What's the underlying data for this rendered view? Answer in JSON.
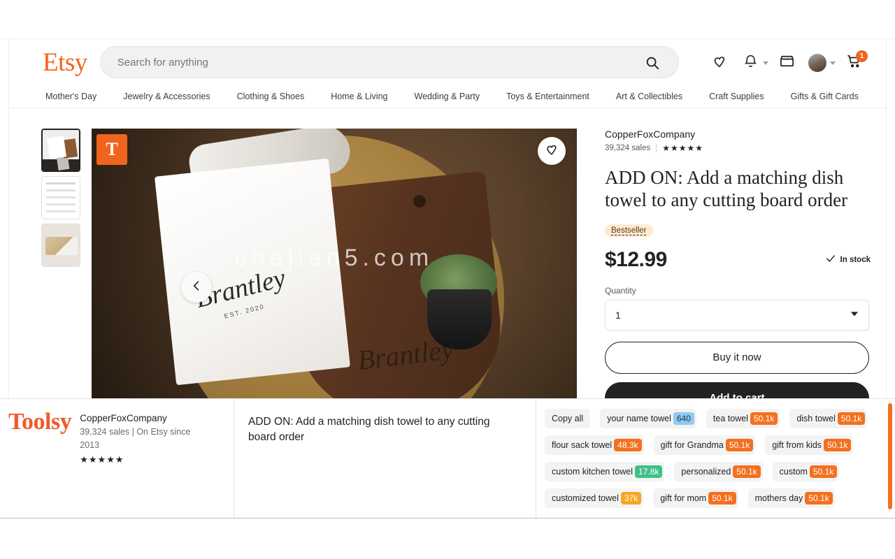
{
  "header": {
    "logo_text": "Etsy",
    "search": {
      "placeholder": "Search for anything",
      "value": ""
    },
    "icons": {
      "favorites": "heart-icon",
      "notifications": "bell-icon",
      "shop_manager": "storefront-icon",
      "account": "avatar-icon",
      "cart": "cart-icon"
    },
    "cart_count": "1",
    "nav": [
      "Mother's Day",
      "Jewelry & Accessories",
      "Clothing & Shoes",
      "Home & Living",
      "Wedding & Party",
      "Toys & Entertainment",
      "Art & Collectibles",
      "Craft Supplies",
      "Gifts & Gift Cards"
    ]
  },
  "gallery": {
    "badge_letter": "T",
    "favorite_label": "♡",
    "prev_label": "‹",
    "next_label": "›",
    "watermark": "chajian5.com",
    "towel_script": "Brantley",
    "towel_est": "EST. 2020",
    "board_script": "Brantley",
    "thumbnails": [
      {
        "name": "thumbnail-1",
        "alt": "Add on dish towel product photo"
      },
      {
        "name": "thumbnail-2",
        "alt": "Listing description text image"
      },
      {
        "name": "thumbnail-3",
        "alt": "Cutting board with towel photo"
      }
    ]
  },
  "listing": {
    "shop_name": "CopperFoxCompany",
    "sales": "39,324 sales",
    "stars": "★★★★★",
    "title": "ADD ON: Add a matching dish towel to any cutting board order",
    "badge": "Bestseller",
    "price": "$12.99",
    "stock": "In stock",
    "quantity_label": "Quantity",
    "quantity_value": "1",
    "buy_now_label": "Buy it now",
    "add_to_cart_label": "Add to cart"
  },
  "toolsy": {
    "logo_text": "Toolsy",
    "shop_name": "CopperFoxCompany",
    "shop_meta": "39,324 sales | On Etsy since 2013",
    "stars": "★★★★★",
    "listing_title": "ADD ON: Add a matching dish towel to any cutting board order",
    "copy_all_label": "Copy all",
    "tags": [
      {
        "label": "your name towel",
        "count": "640",
        "color": "blue"
      },
      {
        "label": "tea towel",
        "count": "50.1k",
        "color": "orange"
      },
      {
        "label": "dish towel",
        "count": "50.1k",
        "color": "orange"
      },
      {
        "label": "flour sack towel",
        "count": "48.3k",
        "color": "orange"
      },
      {
        "label": "gift for Grandma",
        "count": "50.1k",
        "color": "orange"
      },
      {
        "label": "gift from kids",
        "count": "50.1k",
        "color": "orange"
      },
      {
        "label": "custom kitchen towel",
        "count": "17.8k",
        "color": "green"
      },
      {
        "label": "personalized",
        "count": "50.1k",
        "color": "orange"
      },
      {
        "label": "custom",
        "count": "50.1k",
        "color": "orange"
      },
      {
        "label": "customized towel",
        "count": "37k",
        "color": "amber"
      },
      {
        "label": "gift for mom",
        "count": "50.1k",
        "color": "orange"
      },
      {
        "label": "mothers day",
        "count": "50.1k",
        "color": "orange"
      }
    ]
  },
  "colors": {
    "etsy_orange": "#f1641e",
    "toolsy_orange": "#ef5b28",
    "tag_orange": "#f4701f",
    "tag_blue": "#8ecbf2",
    "tag_green": "#3fc08a",
    "tag_amber": "#f5a623"
  }
}
